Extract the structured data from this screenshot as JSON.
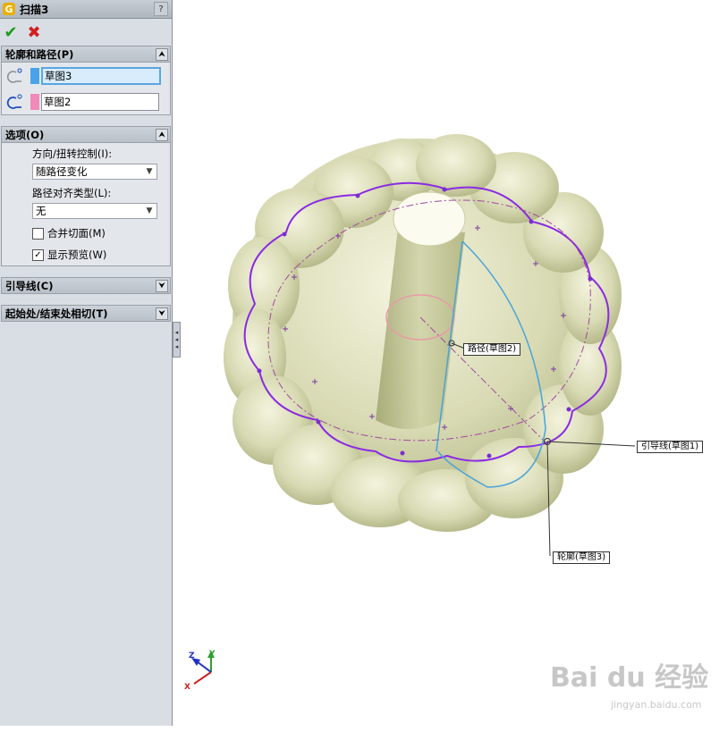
{
  "title": {
    "text": "扫描3",
    "help": "?"
  },
  "actions": {
    "ok": "✔",
    "cancel": "✖"
  },
  "profile_path": {
    "header": "轮廓和路径(P)",
    "profile_value": "草图3",
    "path_value": "草图2",
    "profile_color": "#4aa3e8",
    "path_color": "#f08ab8"
  },
  "options": {
    "header": "选项(O)",
    "orientation_label": "方向/扭转控制(I):",
    "orientation_value": "随路径变化",
    "path_align_label": "路径对齐类型(L):",
    "path_align_value": "无",
    "merge_faces_label": "合并切面(M)",
    "merge_faces_checked": false,
    "show_preview_label": "显示预览(W)",
    "show_preview_checked": true
  },
  "guide_curves": {
    "header": "引导线(C)"
  },
  "tangency": {
    "header": "起始处/结束处相切(T)"
  },
  "callouts": {
    "path": "路径(草图2)",
    "guide": "引导线(草图1)",
    "profile": "轮廓(草图3)"
  },
  "triad": {
    "x": "X",
    "y": "Y",
    "z": "Z"
  },
  "watermark": {
    "main": "Bai du 经验",
    "sub": "jingyan.baidu.com"
  }
}
